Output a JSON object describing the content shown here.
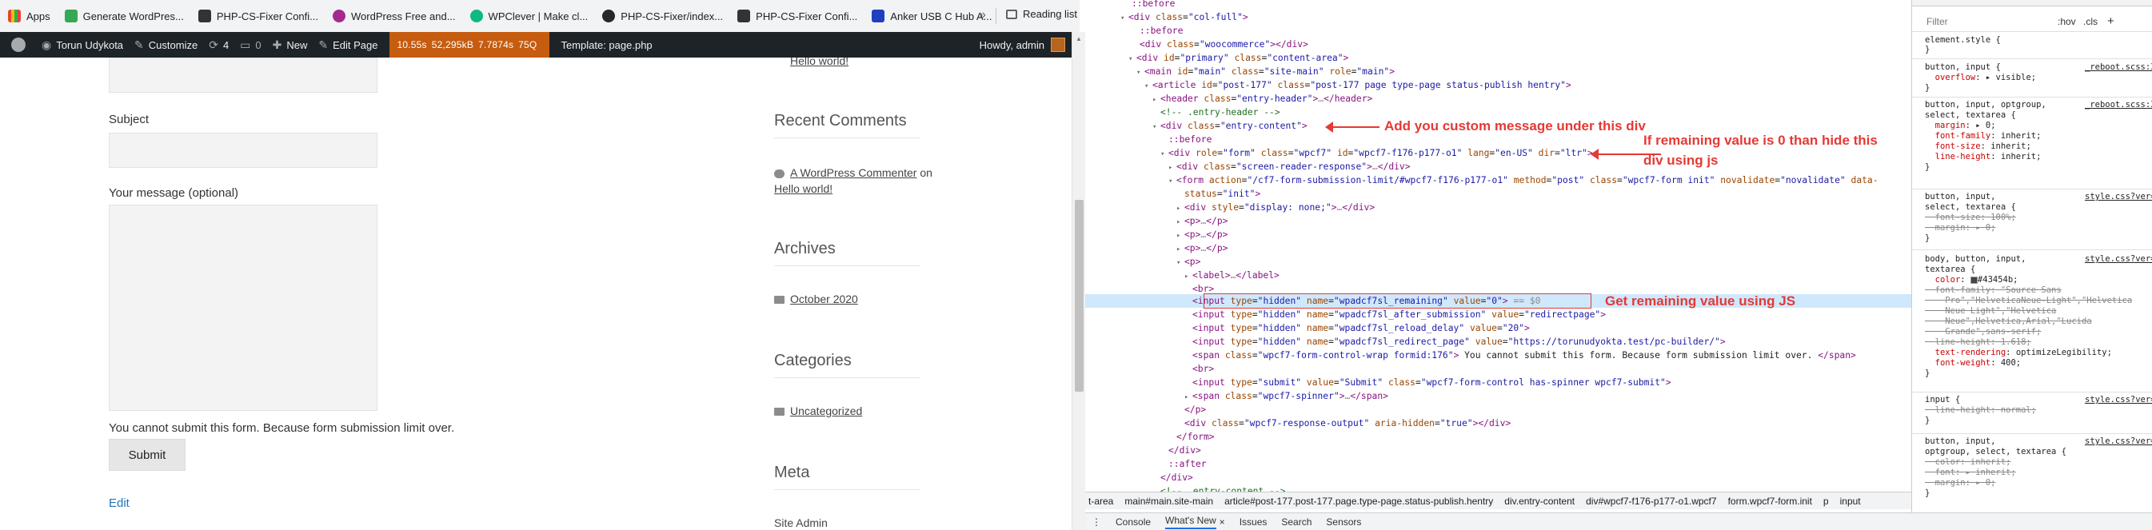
{
  "bookmarks": {
    "items": [
      {
        "label": "Apps",
        "color": "#ea4335"
      },
      {
        "label": "Generate WordPres...",
        "color": "#34a853"
      },
      {
        "label": "PHP-CS-Fixer Confi...",
        "color": "#333333"
      },
      {
        "label": "WordPress Free and...",
        "color": "#a52a8e"
      },
      {
        "label": "WPClever | Make cl...",
        "color": "#10b981"
      },
      {
        "label": "PHP-CS-Fixer/index...",
        "color": "#24292e"
      },
      {
        "label": "PHP-CS-Fixer Confi...",
        "color": "#333333"
      },
      {
        "label": "Anker USB C Hub A...",
        "color": "#1f3fbf"
      }
    ],
    "more": "»",
    "reading_list": "Reading list"
  },
  "adminbar": {
    "site": "Torun Udykota",
    "customize": "Customize",
    "updates": "4",
    "comments": "0",
    "new": "New",
    "edit_page": "Edit Page",
    "perf": [
      "10.55s",
      "52,295kB",
      "7.7874s",
      "75Q"
    ],
    "template": "Template: page.php",
    "howdy": "Howdy, admin"
  },
  "form": {
    "subject_label": "Subject",
    "message_label": "Your message (optional)",
    "limit_message": "You cannot submit this form. Because form submission limit over.",
    "submit": "Submit",
    "edit": "Edit"
  },
  "sidebar": {
    "hello_world_top": "Hello world!",
    "recent_comments_title": "Recent Comments",
    "commenter": "A WordPress Commenter",
    "on": "on",
    "comment_post": "Hello world!",
    "archives_title": "Archives",
    "archive_item": "October 2020",
    "categories_title": "Categories",
    "category_item": "Uncategorized",
    "meta_title": "Meta",
    "meta_item": "Site Admin"
  },
  "annotations": {
    "custom_message": "Add you custom message under this div",
    "hide_div_1": "If remaining value is 0 than hide this",
    "hide_div_2": "div using js",
    "get_remaining": "Get  remaining value using JS"
  },
  "crumbs": [
    "t-area",
    "main#main.site-main",
    "article#post-177.post-177.page.type-page.status-publish.hentry",
    "div.entry-content",
    "div#wpcf7-f176-p177-o1.wpcf7",
    "form.wpcf7-form.init",
    "p",
    "input"
  ],
  "drawer": {
    "menu": "⋮",
    "tabs": [
      "Console",
      "What's New",
      "Issues",
      "Search",
      "Sensors"
    ],
    "active": "What's New",
    "close": "×"
  },
  "styles_panel": {
    "filter_placeholder": "Filter",
    "hov": ":hov",
    "cls": ".cls",
    "plus": "+"
  }
}
